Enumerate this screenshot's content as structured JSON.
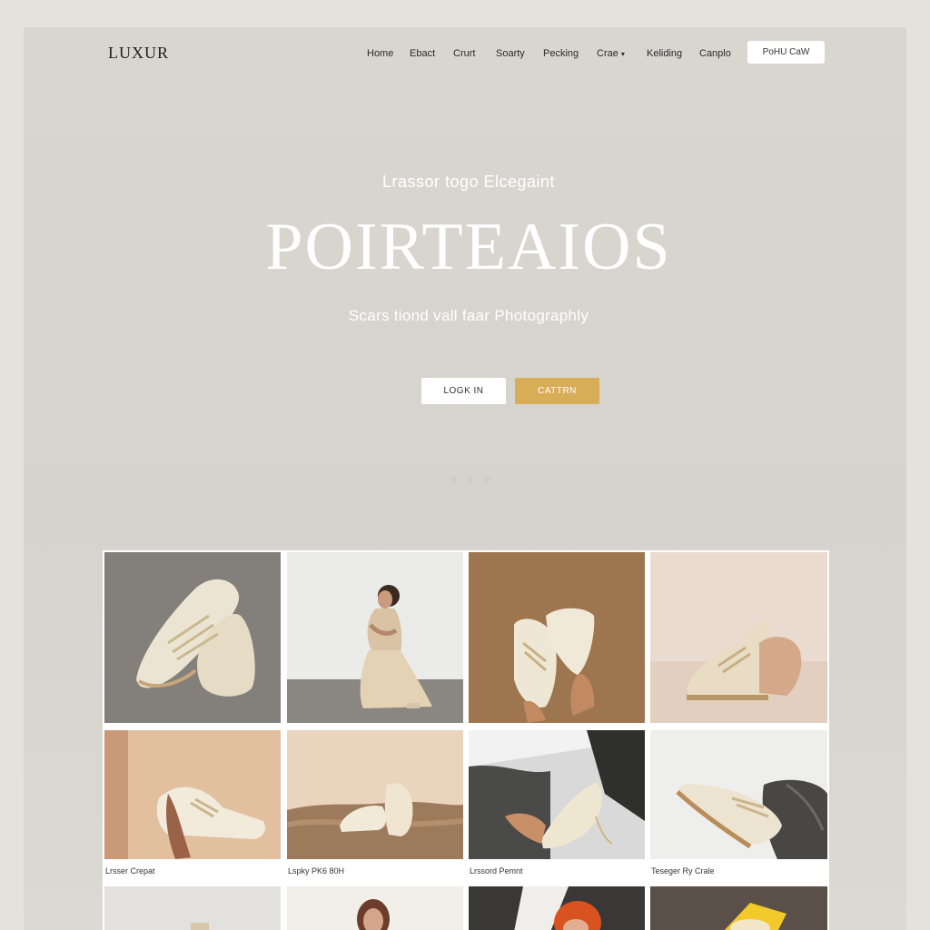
{
  "header": {
    "logo": "LUXUR",
    "nav": [
      {
        "label": "Home",
        "dropdown": false
      },
      {
        "label": "Ebact",
        "dropdown": false
      },
      {
        "label": "Crurt",
        "dropdown": false
      },
      {
        "label": "Soarty",
        "dropdown": false
      },
      {
        "label": "Pecking",
        "dropdown": false
      },
      {
        "label": "Crae",
        "dropdown": true
      },
      {
        "label": "Keliding",
        "dropdown": false
      },
      {
        "label": "Canplo",
        "dropdown": false
      }
    ],
    "cta_label": "PoHU CaW"
  },
  "hero": {
    "eyebrow": "Lrassor togo Elcegaint",
    "title": "POIRTEAIOS",
    "subtitle": "Scars tiond vall faar Photographly",
    "login_label": "LOGK IN",
    "cta_label": "CATTRN",
    "slide_count": 3,
    "active_slide": 0
  },
  "gallery": {
    "tiles": [
      {
        "caption": "",
        "scene": "sneakers-on-concrete"
      },
      {
        "caption": "",
        "scene": "model-seated"
      },
      {
        "caption": "",
        "scene": "hands-holding-shoes"
      },
      {
        "caption": "",
        "scene": "sneaker-pair-beige"
      },
      {
        "caption": "Lrsser Crepat",
        "scene": "hand-wall-sneaker"
      },
      {
        "caption": "Lspky PK6 80H",
        "scene": "sneakers-on-sand"
      },
      {
        "caption": "Lrssord Pemnt",
        "scene": "hand-dark-sneaker"
      },
      {
        "caption": "Teseger Ry Crale",
        "scene": "sneaker-with-fabric"
      },
      {
        "caption": "",
        "scene": "light-product"
      },
      {
        "caption": "",
        "scene": "model-portrait"
      },
      {
        "caption": "",
        "scene": "redhead-portrait"
      },
      {
        "caption": "",
        "scene": "yellow-product"
      }
    ]
  },
  "colors": {
    "background": "#e4e2dd",
    "hero": "#d8d5cf",
    "accent": "#d8ad58",
    "text": "#2a2a28"
  }
}
